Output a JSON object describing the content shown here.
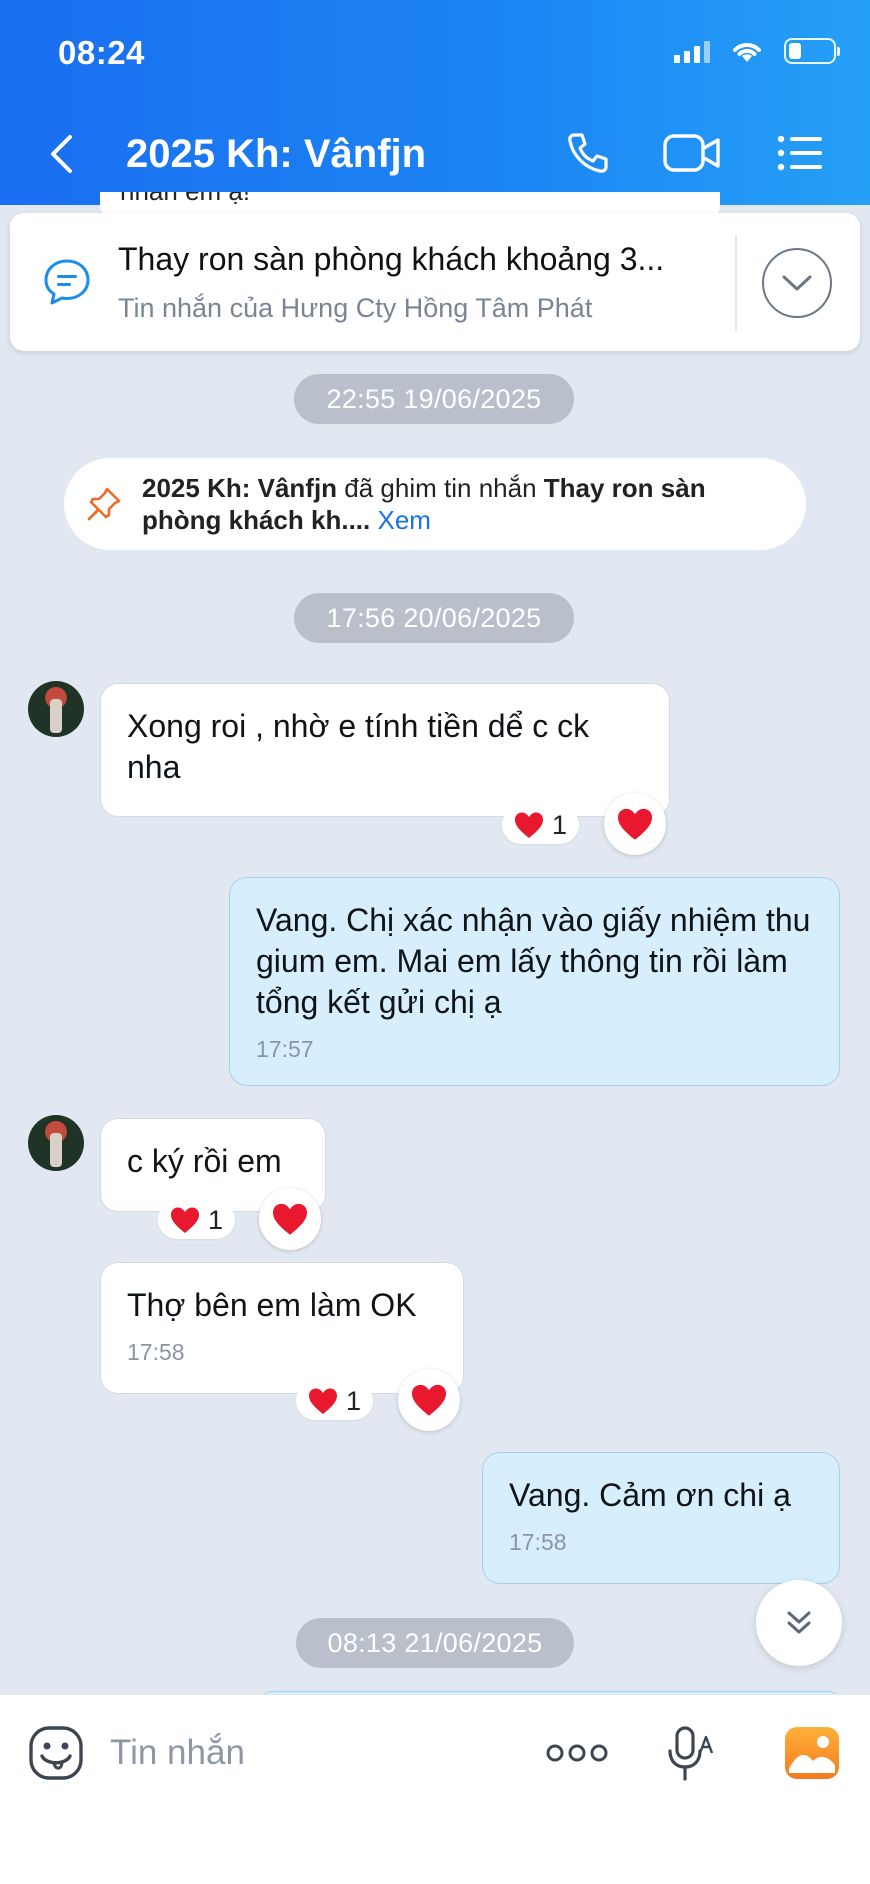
{
  "status_bar": {
    "time": "08:24"
  },
  "header": {
    "title": "2025 Kh: Vânfjn",
    "accent": "#1a6ef0"
  },
  "pinned": {
    "peek_text": "nhắn em ạ!",
    "title": "Thay ron sàn phòng khách khoảng 3...",
    "subtitle": "Tin nhắn của Hưng Cty Hồng Tâm Phát"
  },
  "dates": [
    "22:55 19/06/2025",
    "17:56 20/06/2025",
    "08:13 21/06/2025"
  ],
  "pin_notice": {
    "actor": "2025 Kh: Vânfjn",
    "action": " đã ghim tin nhắn ",
    "message": "Thay ron sàn phòng khách kh....",
    "link": " Xem"
  },
  "messages": [
    {
      "side": "in",
      "text": "Xong roi , nhờ e tính tiền dể c ck nha",
      "reaction_count": "1"
    },
    {
      "side": "out",
      "text": "Vang. Chị xác nhận vào giấy nhiệm thu gium em. Mai em lấy thông tin rồi làm tổng kết gửi chị ạ",
      "time": "17:57"
    },
    {
      "side": "in",
      "text": "c ký rồi em",
      "reaction_count": "1"
    },
    {
      "side": "in",
      "text": "Thợ bên em làm OK",
      "time": "17:58",
      "reaction_count": "1"
    },
    {
      "side": "out",
      "text": "Vang. Cảm ơn chi ạ",
      "time": "17:58"
    }
  ],
  "input": {
    "placeholder": "Tin nhắn"
  },
  "icons": [
    "back-icon",
    "phone-icon",
    "video-call-icon",
    "menu-list-icon",
    "pinned-message-icon",
    "expand-icon",
    "pin-icon",
    "heart-icon",
    "scroll-down-icon",
    "emoji-icon",
    "more-icon",
    "voice-icon",
    "gallery-icon"
  ]
}
